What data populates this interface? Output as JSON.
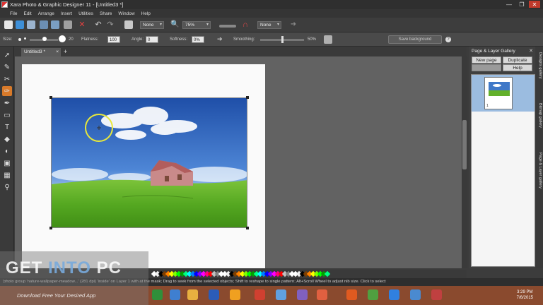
{
  "window": {
    "title": "Xara Photo & Graphic Designer 11 - [Untitled3 *]",
    "controls": [
      "—",
      "❐",
      "✕"
    ]
  },
  "menu": [
    "File",
    "Edit",
    "Arrange",
    "Insert",
    "Utilities",
    "Share",
    "Window",
    "Help"
  ],
  "toolbar": {
    "combo1": "None",
    "zoom": "75%",
    "combo3": "None"
  },
  "infobar": {
    "size_label": "Size:",
    "size_value": "20",
    "flatness_label": "Flatness:",
    "flatness_value": "100",
    "angle_label": "Angle:",
    "angle_value": "0",
    "softness_label": "Softness:",
    "softness_value": "0%",
    "smoothing_label": "Smoothing:",
    "smoothing_value": "50%",
    "save_background": "Save background"
  },
  "document": {
    "tab": "Untitled3 *",
    "tab_close": "×",
    "add_tab": "+"
  },
  "gallery": {
    "title": "Page & Layer Gallery",
    "new_page": "New page",
    "duplicate": "Duplicate",
    "help": "Help",
    "page_number": "1",
    "side_tabs": [
      "Designs gallery",
      "Bitmap gallery",
      "Page & Layer gallery"
    ]
  },
  "status": {
    "message": "'photo group 'nature-wallpaper-meadow...' (281 dpi) 'inside' on Layer 1 with at the mask; Drag to seek from the selected objects; Shift to reshape to single pattern; Alt+Scroll Wheel to adjust nib size. Click to select"
  },
  "taskbar": {
    "time": "3:29 PM",
    "date": "7/6/2015"
  },
  "watermark": {
    "logo_pre": "GET ",
    "logo_mid": "INTO",
    "logo_post": " PC",
    "tagline": "Download Free Your Desired App"
  },
  "colors": {
    "accent": "#d87a2a",
    "taskbar": "#8a4a2e",
    "palette": [
      "#ffffff",
      "#f0f0f0",
      "#000000",
      "#7f3f00",
      "#ff8000",
      "#ffff00",
      "#80ff00",
      "#00ff00",
      "#00a000",
      "#00ff80",
      "#00ffff",
      "#0080ff",
      "#0000ff",
      "#8000ff",
      "#ff00ff",
      "#ff0080",
      "#ff0000",
      "#c0c0c0",
      "#808080",
      "#ffffff"
    ]
  }
}
